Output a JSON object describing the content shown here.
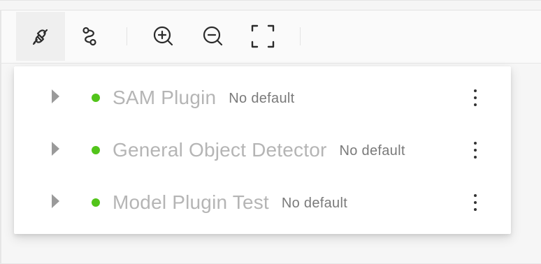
{
  "colors": {
    "icon": "#2b2b2b",
    "status_green": "#52c41a",
    "name_text": "#b5b5b5",
    "default_text": "#7a7a7a"
  },
  "toolbar": {
    "buttons": [
      {
        "id": "plugin",
        "icon": "plug-icon",
        "active": true
      },
      {
        "id": "workflow",
        "icon": "workflow-icon",
        "active": false
      },
      {
        "id": "zoom-in",
        "icon": "zoom-in-icon",
        "active": false
      },
      {
        "id": "zoom-out",
        "icon": "zoom-out-icon",
        "active": false
      },
      {
        "id": "fullscreen",
        "icon": "fullscreen-icon",
        "active": false
      }
    ]
  },
  "plugins": [
    {
      "name": "SAM Plugin",
      "default_label": "No default",
      "status": "online"
    },
    {
      "name": "General Object Detector",
      "default_label": "No default",
      "status": "online"
    },
    {
      "name": "Model Plugin Test",
      "default_label": "No default",
      "status": "online"
    }
  ]
}
